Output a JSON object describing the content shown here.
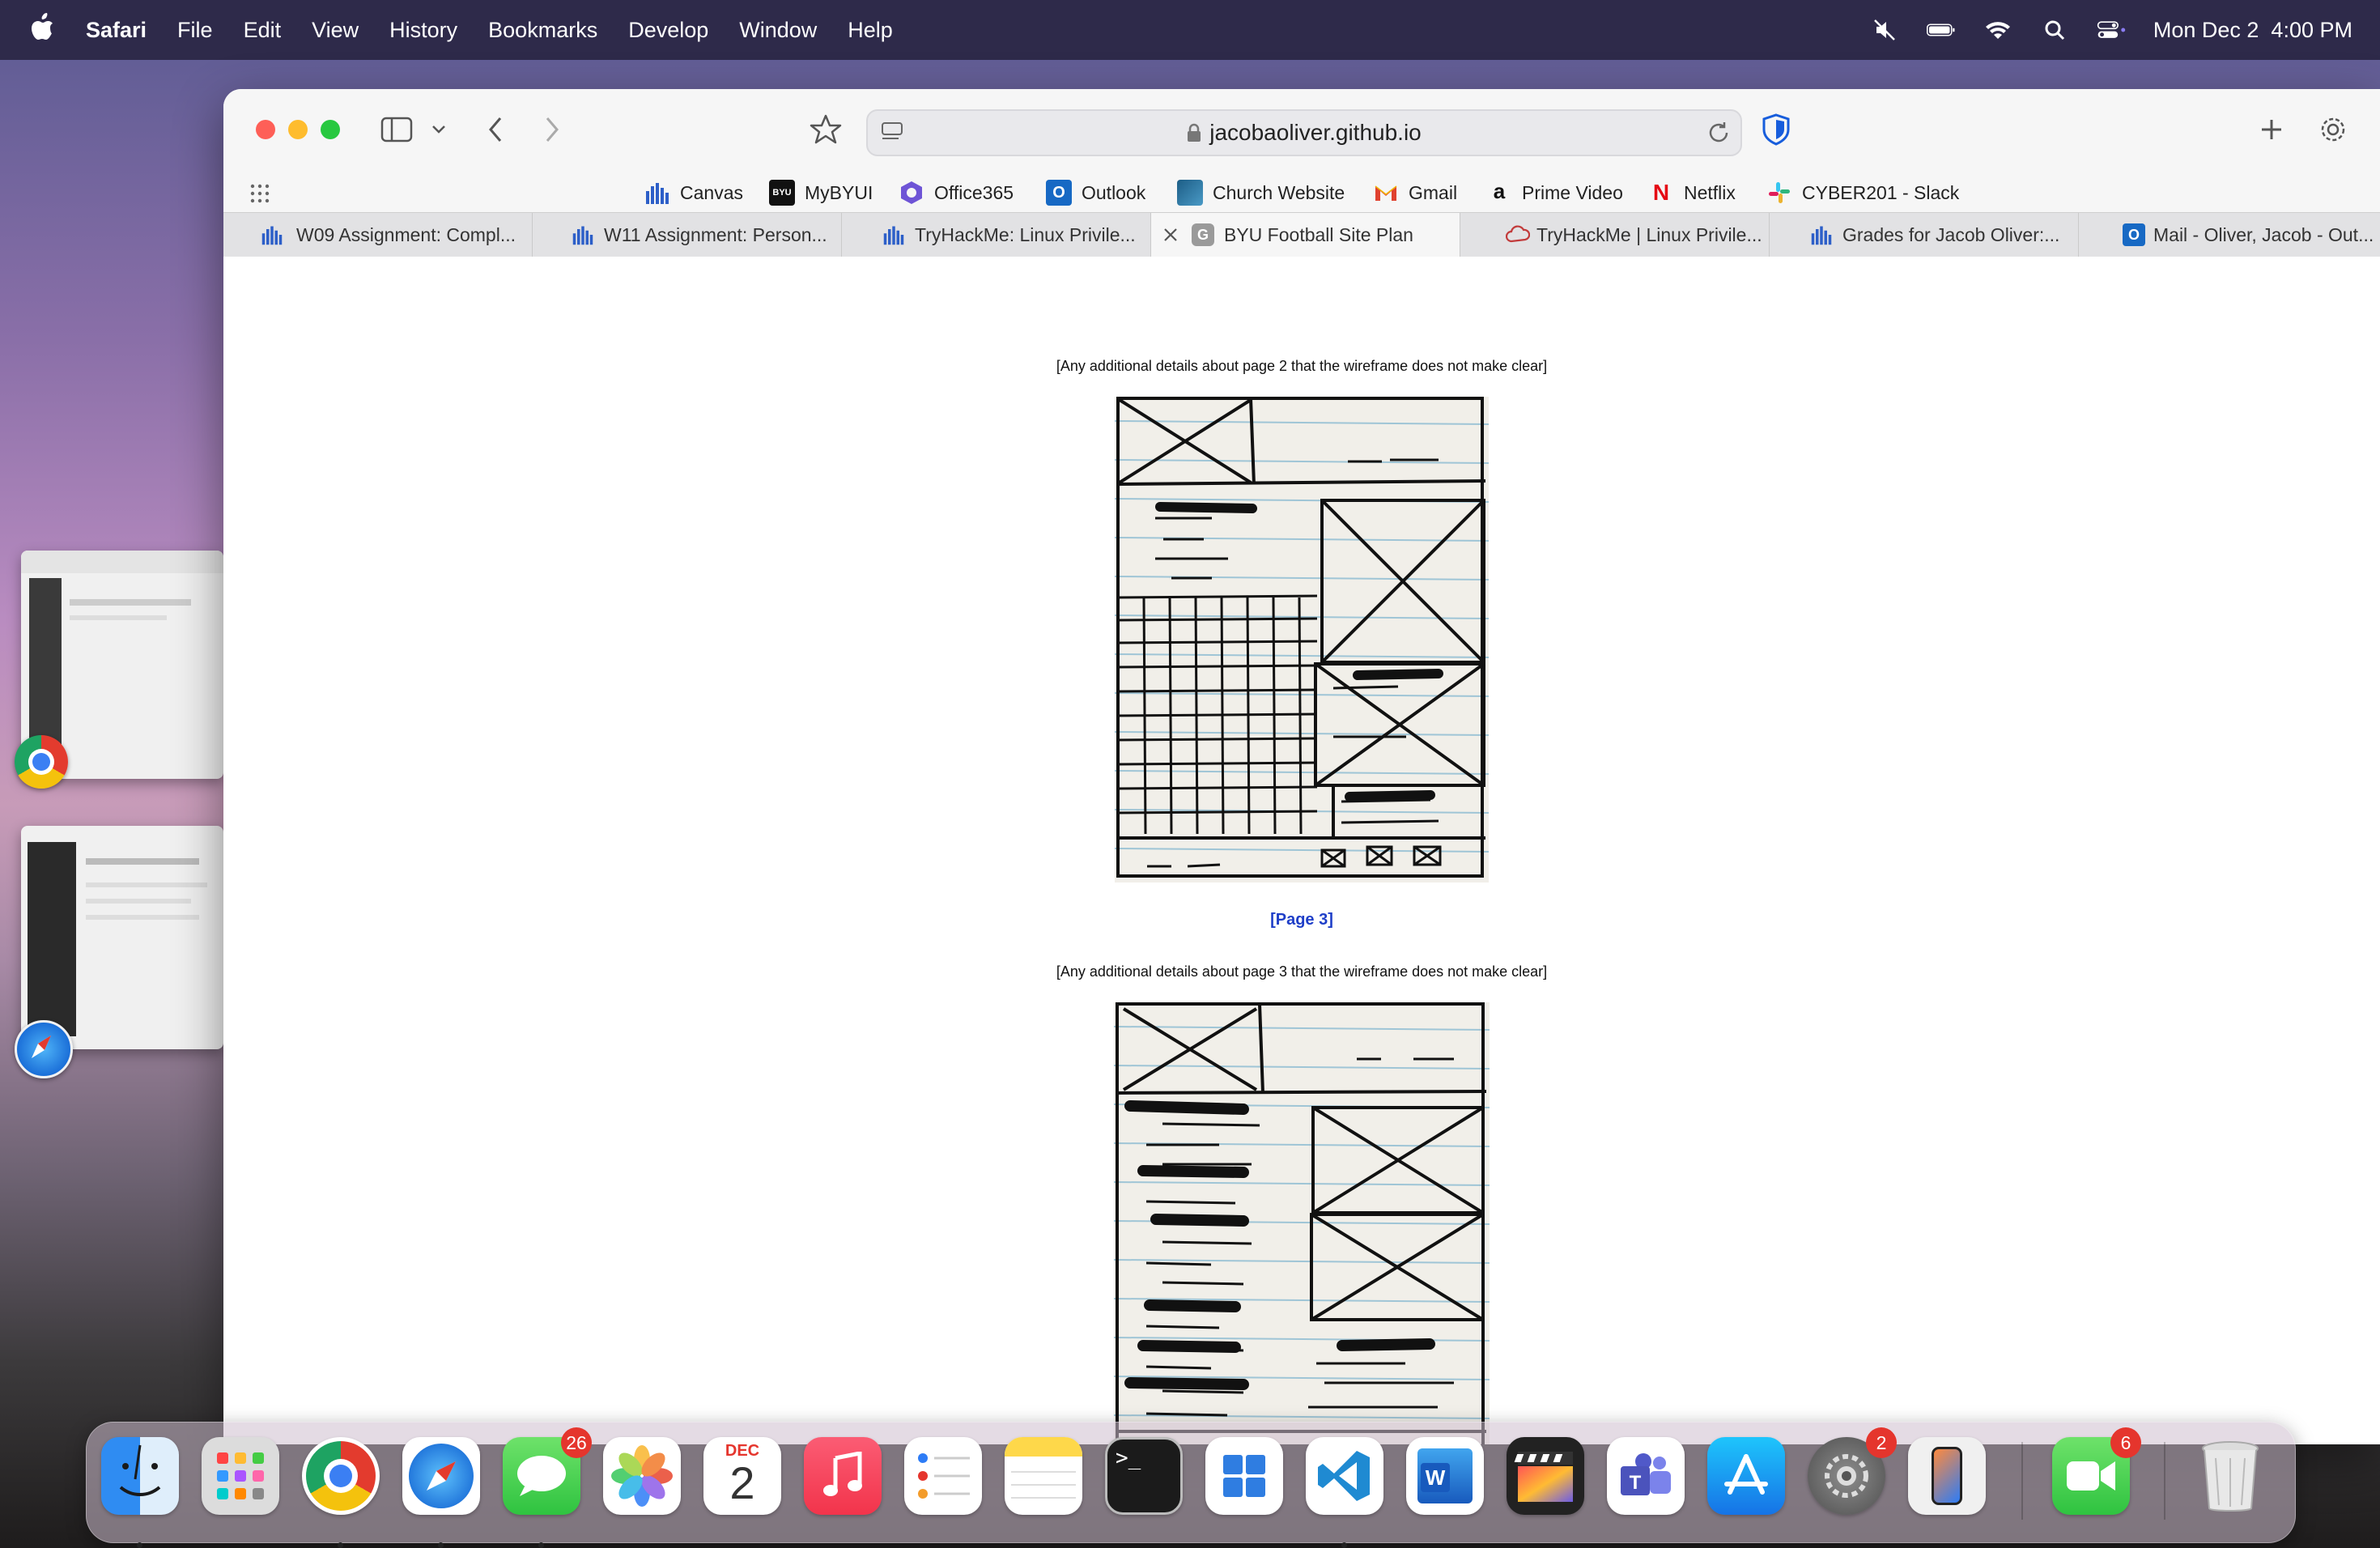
{
  "menubar": {
    "app_name": "Safari",
    "items": [
      "File",
      "Edit",
      "View",
      "History",
      "Bookmarks",
      "Develop",
      "Window",
      "Help"
    ],
    "clock": "Mon Dec 2  4:00 PM"
  },
  "browser": {
    "url": "jacobaoliver.github.io",
    "bookmarks": [
      "Canvas",
      "MyBYUI",
      "Office365",
      "Outlook",
      "Church Website",
      "Gmail",
      "Prime Video",
      "Netflix",
      "CYBER201 - Slack"
    ],
    "tabs": [
      {
        "label": "W09 Assignment: Compl..."
      },
      {
        "label": "W11 Assignment: Person..."
      },
      {
        "label": "TryHackMe: Linux Privile..."
      },
      {
        "label": "BYU Football Site Plan"
      },
      {
        "label": "TryHackMe | Linux Privile..."
      },
      {
        "label": "Grades for Jacob Oliver:..."
      },
      {
        "label": "Mail - Oliver, Jacob - Out..."
      }
    ]
  },
  "content": {
    "caption_page2": "[Any additional details about page 2 that the wireframe does not make clear]",
    "page3_link": "[Page 3]",
    "caption_page3": "[Any additional details about page 3 that the wireframe does not make clear]"
  },
  "dock": {
    "messages_badge": "26",
    "calendar_month": "DEC",
    "calendar_day": "2",
    "settings_badge": "2",
    "facetime_badge": "6"
  },
  "colors": {
    "menubar": "#2e2a4a",
    "link": "#1e3ec8",
    "badge": "#e5352d"
  }
}
